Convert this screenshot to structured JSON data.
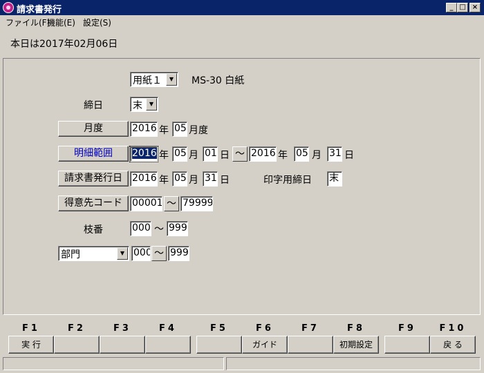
{
  "window": {
    "title": "請求書発行",
    "minimize": "_",
    "maximize": "□",
    "close": "×"
  },
  "menu": [
    "ファイル(F)",
    "機能(E)",
    "設定(S)"
  ],
  "today": "本日は2017年02月06日",
  "paper": {
    "selected": "用紙１",
    "desc": "MS-30 白紙"
  },
  "closing_day": {
    "label": "締日",
    "value": "末"
  },
  "month": {
    "label": "月度",
    "year": "2016",
    "year_unit": "年",
    "month": "05",
    "month_unit": "月度"
  },
  "detail_range": {
    "label": "明細範囲",
    "from_year": "2016",
    "from_month": "05",
    "from_day": "01",
    "to_year": "2016",
    "to_month": "05",
    "to_day": "31",
    "year_unit": "年",
    "month_unit": "月",
    "day_unit": "日",
    "tilde": "～"
  },
  "issue_date": {
    "label": "請求書発行日",
    "year": "2016",
    "month": "05",
    "day": "31",
    "print_label": "印字用締日",
    "print_value": "末"
  },
  "customer_code": {
    "label": "得意先コード",
    "from": "00001",
    "to": "79999",
    "tilde": "～"
  },
  "branch": {
    "label": "枝番",
    "from": "000",
    "to": "999",
    "tilde": "～"
  },
  "department": {
    "selected": "部門",
    "from": "000",
    "to": "999",
    "tilde": "～"
  },
  "fkeys": [
    {
      "key": "F1",
      "label": "実 行"
    },
    {
      "key": "F2",
      "label": ""
    },
    {
      "key": "F3",
      "label": ""
    },
    {
      "key": "F4",
      "label": ""
    },
    {
      "key": "F5",
      "label": ""
    },
    {
      "key": "F6",
      "label": "ガイド"
    },
    {
      "key": "F7",
      "label": ""
    },
    {
      "key": "F8",
      "label": "初期設定"
    },
    {
      "key": "F9",
      "label": ""
    },
    {
      "key": "F10",
      "label": "戻 る"
    }
  ],
  "colors": {
    "titlebar": "#0a246a",
    "face": "#d4d0c8",
    "highlight_text": "#0000c0"
  }
}
